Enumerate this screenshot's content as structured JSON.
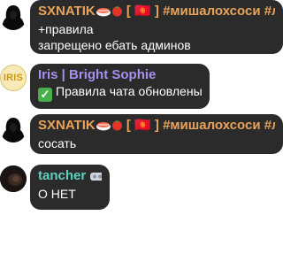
{
  "colors": {
    "bubble_bg": "#2b2b2b",
    "sxnatik_name": "#e9a35a",
    "iris_name": "#a590f0",
    "tancher_name": "#5fd0c0",
    "text": "#ffffff"
  },
  "messages": [
    {
      "author": "SXNATIK",
      "author_suffix": "[ 🇰🇬 ] #мишалохсоси #любл...",
      "lines": [
        "+правила",
        "запрещено ебать админов"
      ]
    },
    {
      "author": "Iris | Bright Sophie",
      "avatar_text": "IRIS",
      "lines": [
        "Правила чата обновлены"
      ]
    },
    {
      "author": "SXNATIK",
      "author_suffix": "[ 🇰🇬 ] #мишалохсоси #любл...",
      "lines": [
        "сосать"
      ]
    },
    {
      "author": "tancher",
      "lines": [
        "О НЕТ"
      ]
    }
  ]
}
